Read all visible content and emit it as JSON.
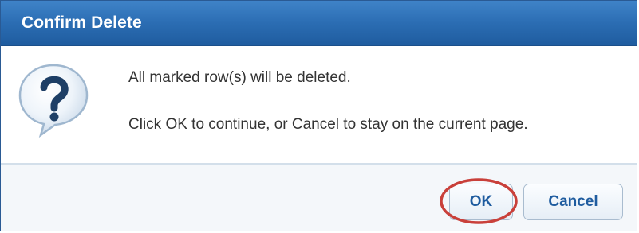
{
  "dialog": {
    "title": "Confirm Delete",
    "icon": "question-balloon-icon",
    "message_line1": "All marked row(s) will be deleted.",
    "message_line2": "Click OK to continue, or Cancel to stay on the current page.",
    "ok_label": "OK",
    "cancel_label": "Cancel",
    "highlighted_button": "OK"
  },
  "colors": {
    "titlebar": "#2b6db3",
    "button_text": "#1f5c9f",
    "highlight_ring": "#c9403a"
  }
}
